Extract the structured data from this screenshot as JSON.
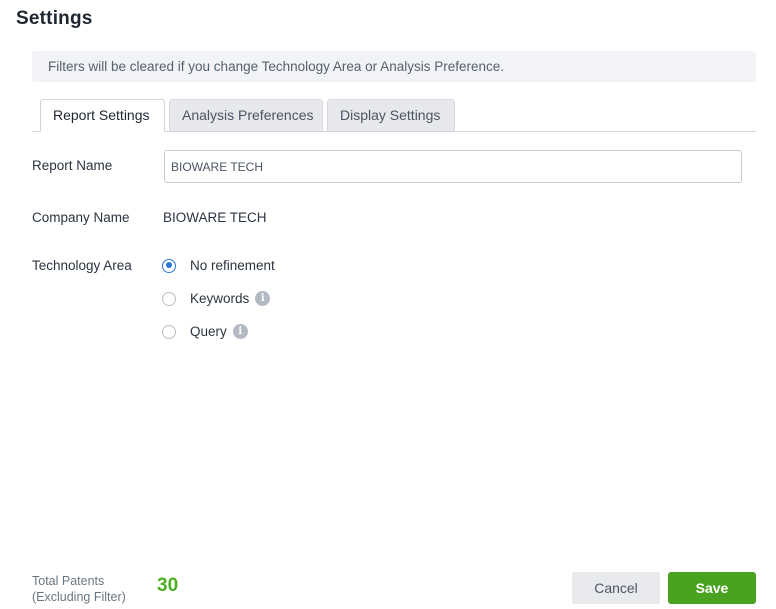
{
  "header": {
    "title": "Settings"
  },
  "notice": {
    "text": "Filters will be cleared if you change Technology Area or Analysis Preference."
  },
  "tabs": [
    {
      "label": "Report Settings",
      "active": true
    },
    {
      "label": "Analysis Preferences",
      "active": false
    },
    {
      "label": "Display Settings",
      "active": false
    }
  ],
  "form": {
    "report_name": {
      "label": "Report Name",
      "value": "BIOWARE TECH"
    },
    "company_name": {
      "label": "Company Name",
      "value": "BIOWARE TECH"
    },
    "technology_area": {
      "label": "Technology Area",
      "options": [
        {
          "label": "No refinement",
          "selected": true,
          "info": false
        },
        {
          "label": "Keywords",
          "selected": false,
          "info": true
        },
        {
          "label": "Query",
          "selected": false,
          "info": true
        }
      ]
    }
  },
  "footer": {
    "total_label_line1": "Total Patents",
    "total_label_line2": "(Excluding Filter)",
    "total_value": "30",
    "cancel_label": "Cancel",
    "save_label": "Save"
  },
  "colors": {
    "accent": "#2b78d4",
    "save": "#4aa320",
    "count": "#4caf1f"
  },
  "icons": {
    "info": "info-icon"
  }
}
